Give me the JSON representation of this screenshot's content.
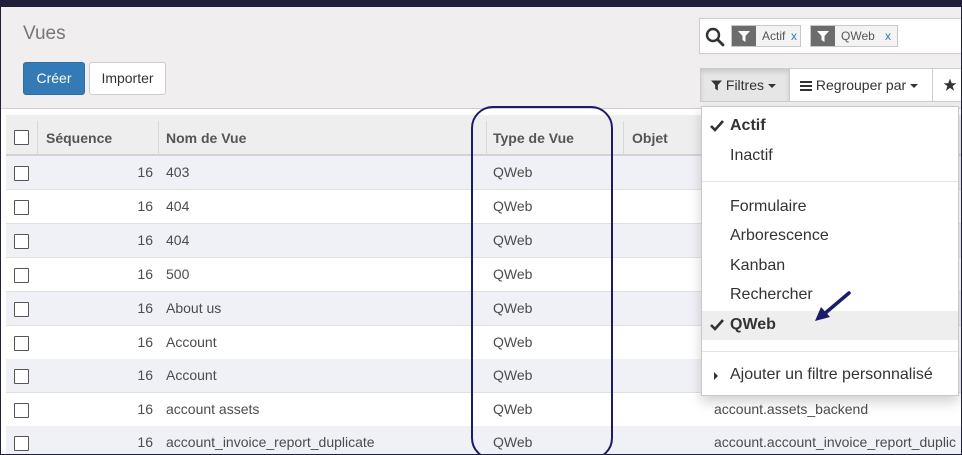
{
  "page": {
    "title": "Vues"
  },
  "buttons": {
    "create": "Créer",
    "import": "Importer"
  },
  "search": {
    "facets": [
      {
        "label": "Actif",
        "remove": "x"
      },
      {
        "label": "QWeb",
        "remove": "x"
      }
    ]
  },
  "toolbar": {
    "filters": "Filtres",
    "group_by": "Regrouper par"
  },
  "table": {
    "headers": {
      "sequence": "Séquence",
      "name": "Nom de Vue",
      "type": "Type de Vue",
      "object": "Objet"
    },
    "rows": [
      {
        "sequence": "16",
        "name": "403",
        "type": "QWeb",
        "object": ""
      },
      {
        "sequence": "16",
        "name": "404",
        "type": "QWeb",
        "object": ""
      },
      {
        "sequence": "16",
        "name": "404",
        "type": "QWeb",
        "object": ""
      },
      {
        "sequence": "16",
        "name": "500",
        "type": "QWeb",
        "object": ""
      },
      {
        "sequence": "16",
        "name": "About us",
        "type": "QWeb",
        "object": ""
      },
      {
        "sequence": "16",
        "name": "Account",
        "type": "QWeb",
        "object": ""
      },
      {
        "sequence": "16",
        "name": "Account",
        "type": "QWeb",
        "object": ""
      },
      {
        "sequence": "16",
        "name": "account assets",
        "type": "QWeb",
        "object": "account.assets_backend"
      },
      {
        "sequence": "16",
        "name": "account_invoice_report_duplicate",
        "type": "QWeb",
        "object": "account.account_invoice_report_duplic"
      }
    ]
  },
  "filter_menu": {
    "status": [
      {
        "label": "Actif",
        "selected": true
      },
      {
        "label": "Inactif",
        "selected": false
      }
    ],
    "types": [
      {
        "label": "Formulaire",
        "selected": false
      },
      {
        "label": "Arborescence",
        "selected": false
      },
      {
        "label": "Kanban",
        "selected": false
      },
      {
        "label": "Rechercher",
        "selected": false
      },
      {
        "label": "QWeb",
        "selected": true
      }
    ],
    "custom": "Ajouter un filtre personnalisé"
  },
  "colors": {
    "primary": "#337ab7",
    "annotation": "#1b1b6b",
    "row_alt": "#f0f0f7"
  }
}
